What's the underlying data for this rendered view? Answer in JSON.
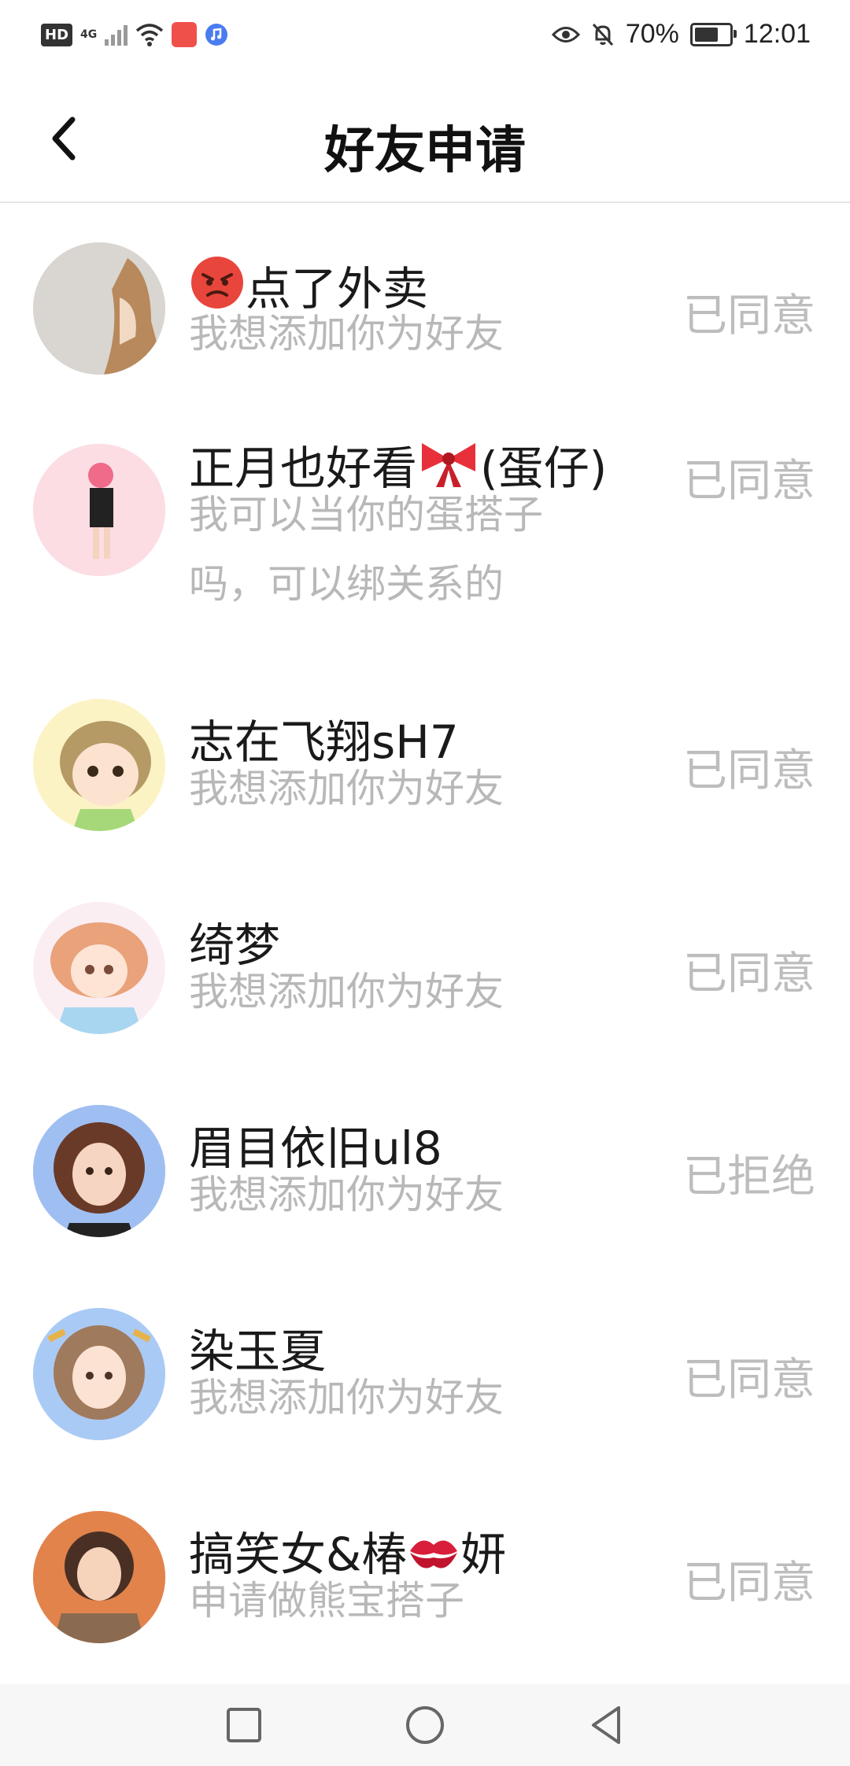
{
  "status_bar": {
    "hd": "HD",
    "network": "4G",
    "battery_percent_label": "70%",
    "battery_level": 0.7,
    "time": "12:01"
  },
  "header": {
    "title": "好友申请"
  },
  "requests": [
    {
      "name": "点了外卖",
      "name_prefix_emoji": "angry-face",
      "message": "我想添加你为好友",
      "status": "已同意"
    },
    {
      "name": "正月也好看",
      "name_suffix_emoji": "ribbon",
      "name_tail": "(蛋仔)",
      "message": "我可以当你的蛋搭子吗，可以绑关系的",
      "status": "已同意"
    },
    {
      "name": "志在飞翔sH7",
      "message": "我想添加你为好友",
      "status": "已同意"
    },
    {
      "name": "绮梦",
      "message": "我想添加你为好友",
      "status": "已同意"
    },
    {
      "name": "眉目依旧ul8",
      "message": "我想添加你为好友",
      "status": "已拒绝"
    },
    {
      "name": "染玉夏",
      "message": "我想添加你为好友",
      "status": "已同意"
    },
    {
      "name": "搞笑女&椿",
      "name_suffix_emoji": "kiss-mark",
      "name_tail": "妍",
      "message": "申请做熊宝搭子",
      "status": "已同意"
    }
  ],
  "nav": {
    "recents_icon": "square-icon",
    "home_icon": "circle-icon",
    "back_icon": "triangle-back-icon"
  }
}
